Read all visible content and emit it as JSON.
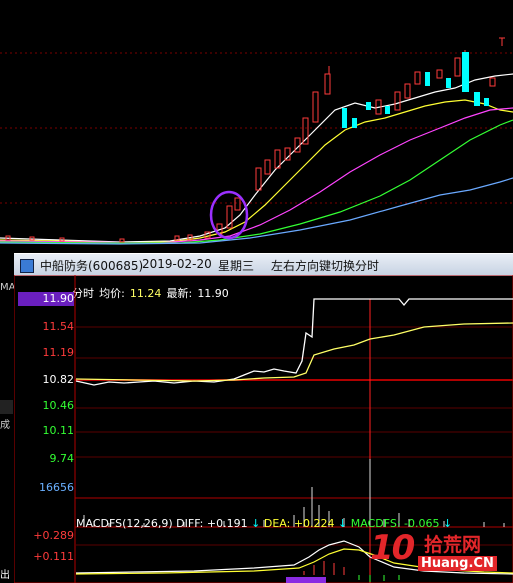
{
  "window": {
    "title_stock": "中船防务(600685)",
    "title_date": "2019-02-20",
    "title_weekday": "星期三",
    "title_hint": "左右方向键切换分时"
  },
  "timeshare": {
    "label": "分时",
    "avg_label": "均价:",
    "avg_value": "11.24",
    "last_label": "最新:",
    "last_value": "11.90",
    "price_labels": [
      "11.90",
      "11.54",
      "11.19",
      "10.82",
      "10.46",
      "10.11",
      "9.74"
    ],
    "volume_label": "16656"
  },
  "macd": {
    "name": "MACDFS(12,26,9)",
    "diff_label": "DIFF:",
    "diff_value": "+0.191",
    "dea_label": "DEA:",
    "dea_value": "+0.224",
    "macdfs_label": "MACDFS:",
    "macdfs_value": "-0.065",
    "axis_labels": [
      "+0.289",
      "+0.111"
    ]
  },
  "side_fragments": [
    "MA",
    "成",
    "出"
  ],
  "watermark": {
    "number": "10",
    "text_cn": "拾荒网",
    "text_en": "Huang.CN"
  },
  "colors": {
    "up": "#ff3b3b",
    "down": "#00ffff",
    "price_line": "#ffffff",
    "avg_line": "#ffff66",
    "accent_purple": "#8a2be2",
    "highlight_circle": "#9b30ff"
  }
}
